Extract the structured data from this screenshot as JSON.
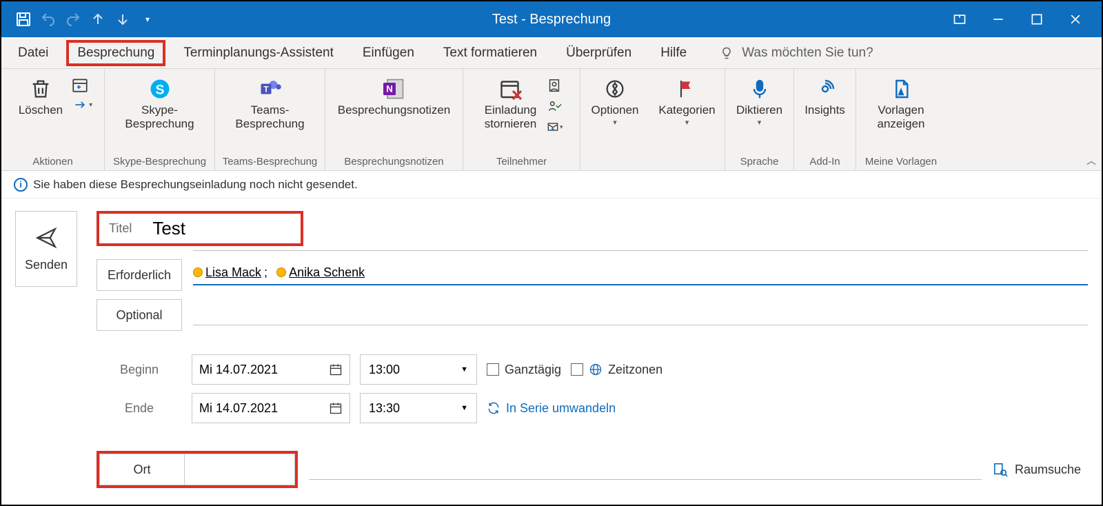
{
  "titlebar": {
    "title": "Test  -  Besprechung"
  },
  "tabs": {
    "datei": "Datei",
    "besprechung": "Besprechung",
    "terminplanung": "Terminplanungs-Assistent",
    "einfuegen": "Einfügen",
    "text_format": "Text formatieren",
    "ueberpruefen": "Überprüfen",
    "hilfe": "Hilfe",
    "tellme": "Was möchten Sie tun?"
  },
  "ribbon": {
    "loeschen": "Löschen",
    "aktionen": "Aktionen",
    "skype_line1": "Skype-",
    "skype_line2": "Besprechung",
    "skype_group": "Skype-Besprechung",
    "teams_line1": "Teams-",
    "teams_line2": "Besprechung",
    "teams_group": "Teams-Besprechung",
    "notizen": "Besprechungsnotizen",
    "notizen_group": "Besprechungsnotizen",
    "einladung_line1": "Einladung",
    "einladung_line2": "stornieren",
    "teilnehmer_group": "Teilnehmer",
    "optionen": "Optionen",
    "kategorien": "Kategorien",
    "diktieren": "Diktieren",
    "sprache_group": "Sprache",
    "insights": "Insights",
    "addin_group": "Add-In",
    "vorlagen_line1": "Vorlagen",
    "vorlagen_line2": "anzeigen",
    "vorlagen_group": "Meine Vorlagen"
  },
  "infobar": {
    "text": "Sie haben diese Besprechungseinladung noch nicht gesendet."
  },
  "form": {
    "senden": "Senden",
    "titel_label": "Titel",
    "titel_value": "Test",
    "erforderlich": "Erforderlich",
    "attendee1": "Lisa Mack",
    "attendee2": "Anika Schenk",
    "optional": "Optional",
    "beginn": "Beginn",
    "ende": "Ende",
    "start_date": "Mi 14.07.2021",
    "start_time": "13:00",
    "end_date": "Mi 14.07.2021",
    "end_time": "13:30",
    "ganztaegig": "Ganztägig",
    "zeitzonen": "Zeitzonen",
    "serie": "In Serie umwandeln",
    "ort": "Ort",
    "raumsuche": "Raumsuche"
  }
}
